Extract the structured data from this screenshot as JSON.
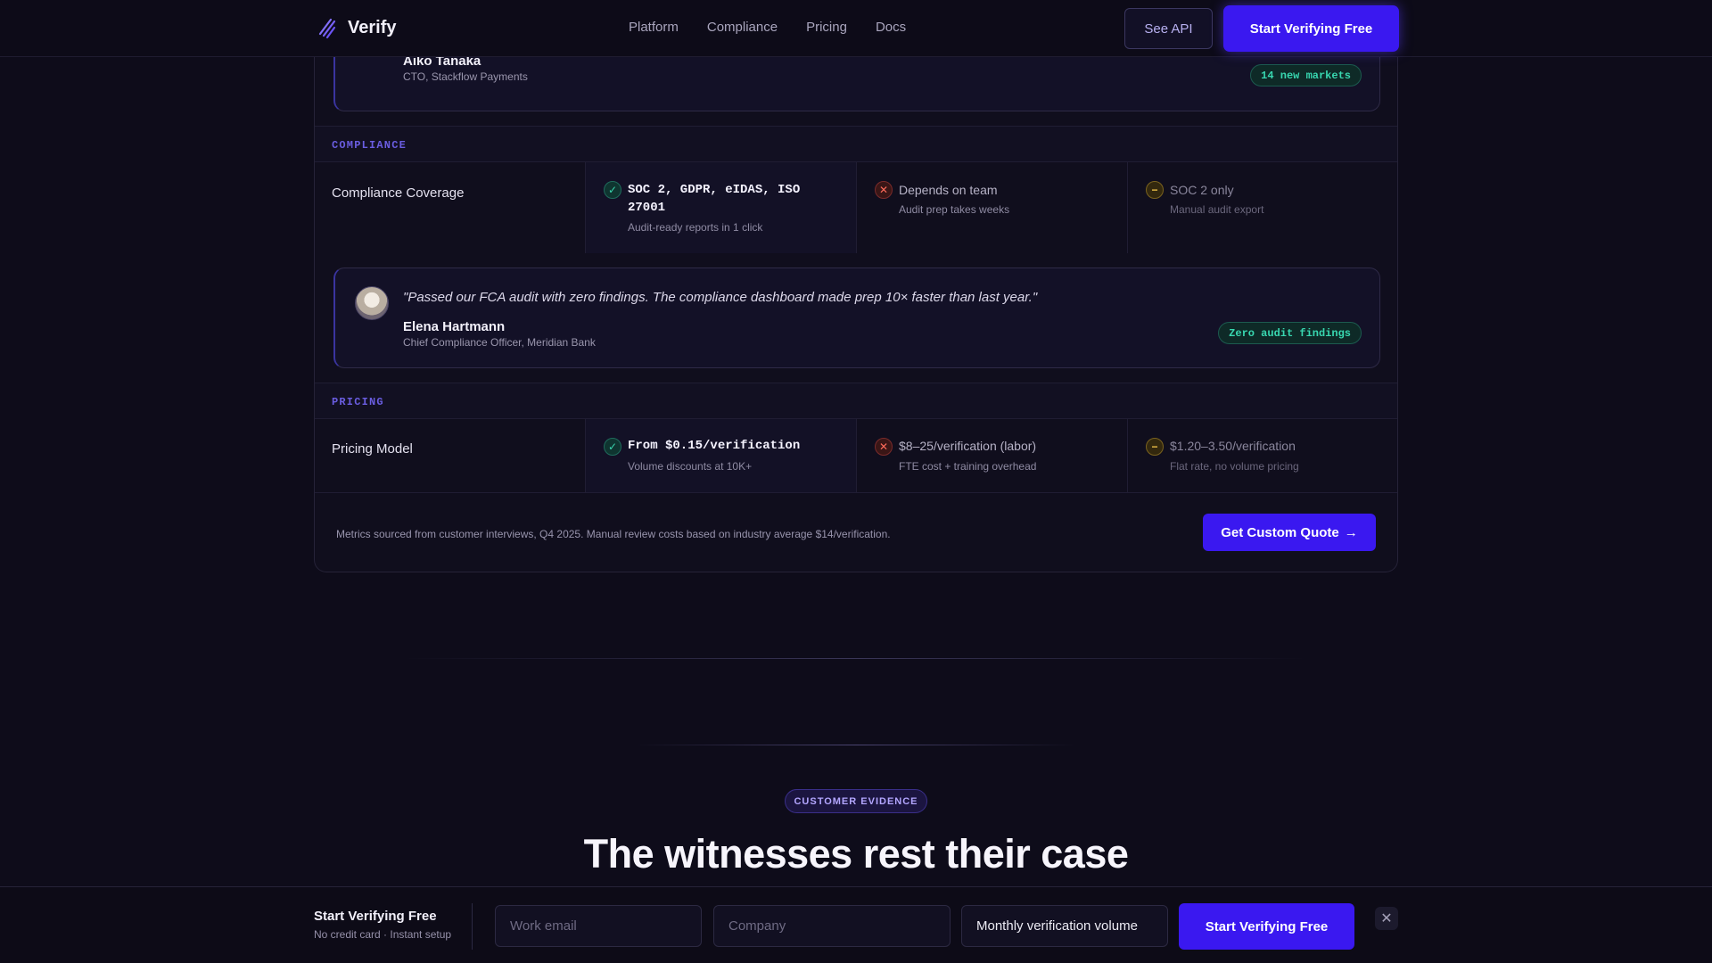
{
  "nav": {
    "brand": "Verify",
    "links": [
      "Platform",
      "Compliance",
      "Pricing",
      "Docs"
    ],
    "see_api": "See API",
    "cta": "Start Verifying Free"
  },
  "testimonials": [
    {
      "quote": "",
      "name": "Aiko Tanaka",
      "role": "CTO, Stackflow Payments",
      "badge": "14 new markets"
    },
    {
      "quote": "\"Passed our FCA audit with zero findings. The compliance dashboard made prep 10× faster than last year.\"",
      "name": "Elena Hartmann",
      "role": "Chief Compliance Officer, Meridian Bank",
      "badge": "Zero audit findings"
    }
  ],
  "sections": {
    "compliance": "COMPLIANCE",
    "pricing": "PRICING"
  },
  "rows": {
    "compliance": {
      "title": "Compliance Coverage",
      "verify": {
        "main": "SOC 2, GDPR, eIDAS, ISO 27001",
        "sub": "Audit-ready reports in 1 click"
      },
      "manual": {
        "main": "Depends on team",
        "sub": "Audit prep takes weeks"
      },
      "other": {
        "main": "SOC 2 only",
        "sub": "Manual audit export"
      }
    },
    "pricing": {
      "title": "Pricing Model",
      "verify": {
        "main": "From $0.15/verification",
        "sub": "Volume discounts at 10K+"
      },
      "manual": {
        "main": "$8–25/verification (labor)",
        "sub": "FTE cost + training overhead"
      },
      "other": {
        "main": "$1.20–3.50/verification",
        "sub": "Flat rate, no volume pricing"
      }
    }
  },
  "footer": {
    "note": "Metrics sourced from customer interviews, Q4 2025. Manual review costs based on industry average $14/verification.",
    "quote_button": "Get Custom Quote",
    "quote_arrow": "→"
  },
  "evidence": {
    "eyebrow": "CUSTOMER EVIDENCE",
    "headline": "The witnesses rest their case"
  },
  "sticky_bar": {
    "title": "Start Verifying Free",
    "subtitle": "No credit card · Instant setup",
    "email_placeholder": "Work email",
    "company_placeholder": "Company",
    "volume_value": "Monthly verification volume",
    "submit": "Start Verifying Free",
    "close": "✕"
  },
  "colors": {
    "accent": "#3a18f0",
    "positive": "#39d4ad",
    "negative": "#ff6a5a",
    "neutral": "#f0c24a"
  }
}
